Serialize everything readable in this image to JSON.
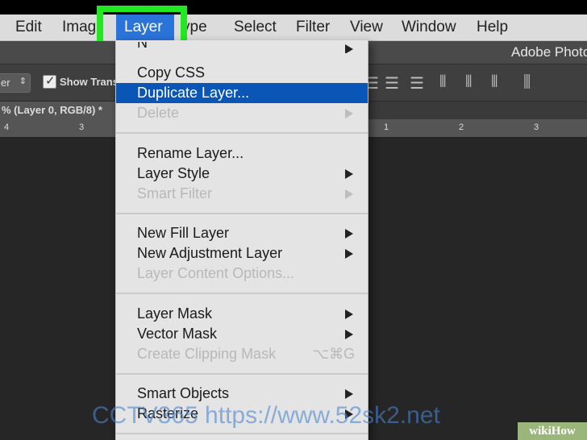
{
  "menubar": {
    "items": [
      "Edit",
      "Imag",
      "Layer",
      "ype",
      "Select",
      "Filter",
      "View",
      "Window",
      "Help"
    ],
    "active": "Layer"
  },
  "title": {
    "text": "Adobe Photo"
  },
  "options": {
    "dropdown_suffix": "er",
    "show_transform_label": "Show Trans"
  },
  "document": {
    "tab_label": "% (Layer 0, RGB/8) *"
  },
  "ruler": {
    "left_ticks": [
      "4",
      "3"
    ],
    "right_ticks": [
      "1",
      "2",
      "3"
    ]
  },
  "dropdown": {
    "first_item_partial": "N",
    "items": [
      {
        "label": "Copy CSS"
      },
      {
        "label": "Duplicate Layer..."
      },
      {
        "label": "Delete"
      },
      {
        "label": "Rename Layer..."
      },
      {
        "label": "Layer Style"
      },
      {
        "label": "Smart Filter"
      },
      {
        "label": "New Fill Layer"
      },
      {
        "label": "New Adjustment Layer"
      },
      {
        "label": "Layer Content Options..."
      },
      {
        "label": "Layer Mask"
      },
      {
        "label": "Vector Mask"
      },
      {
        "label": "Create Clipping Mask",
        "shortcut": "⌥⌘G"
      },
      {
        "label": "Smart Objects"
      },
      {
        "label": "Rasterize"
      }
    ]
  },
  "watermark": {
    "text": "CCTV365  https://www.52sk2.net"
  },
  "badge": {
    "wiki": "wiki",
    "how": "How"
  },
  "colors": {
    "highlight_bg": "#0a56b7",
    "menu_active_bg": "#2a73d9",
    "annotation_border": "#22e822"
  }
}
